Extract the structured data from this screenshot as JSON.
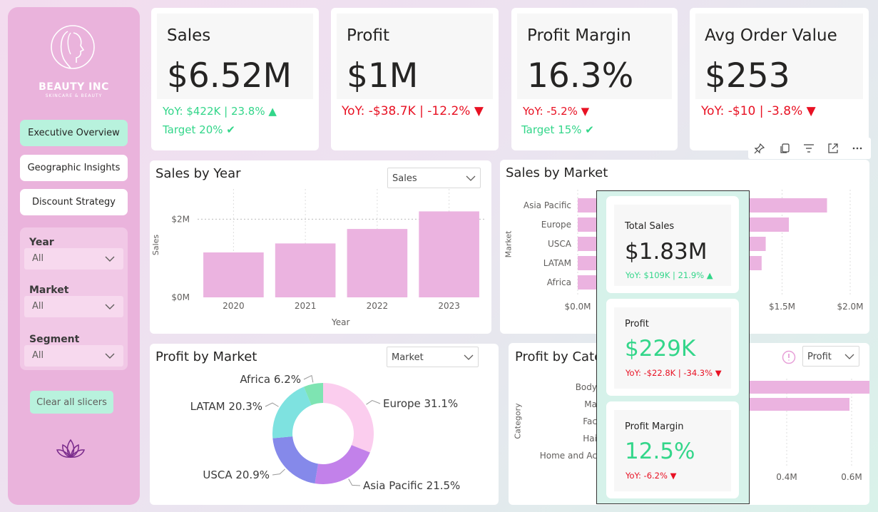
{
  "sidebar": {
    "brand": "BEAUTY INC",
    "tagline": "SKINCARE & BEAUTY",
    "nav": [
      {
        "label": "Executive Overview",
        "active": true
      },
      {
        "label": "Geographic Insights",
        "active": false
      },
      {
        "label": "Discount Strategy",
        "active": false
      }
    ],
    "slicers": [
      {
        "label": "Year",
        "value": "All"
      },
      {
        "label": "Market",
        "value": "All"
      },
      {
        "label": "Segment",
        "value": "All"
      }
    ],
    "clear_label": "Clear all slicers"
  },
  "kpis": [
    {
      "title": "Sales",
      "value": "$6.52M",
      "yoy": "YoY: $422K | 23.8% ▲",
      "yoy_color": "#33d68a",
      "target": "Target 20% ✔"
    },
    {
      "title": "Profit",
      "value": "$1M",
      "yoy": "YoY: -$38.7K | -12.2% ▼",
      "yoy_color": "#e81123",
      "target": ""
    },
    {
      "title": "Profit Margin",
      "value": "16.3%",
      "yoy": "YoY: -5.2% ▼",
      "yoy_color": "#e81123",
      "target": "Target 15% ✔"
    },
    {
      "title": "Avg Order Value",
      "value": "$253",
      "yoy": "YoY: -$10 | -3.8% ▼",
      "yoy_color": "#e81123",
      "target": ""
    }
  ],
  "sales_by_year": {
    "title": "Sales by Year",
    "dropdown": "Sales",
    "chart_data": {
      "type": "bar",
      "categories": [
        "2020",
        "2021",
        "2022",
        "2023"
      ],
      "values": [
        1.15,
        1.38,
        1.75,
        2.2
      ],
      "xlabel": "Year",
      "ylabel": "Sales",
      "yticks": [
        "$0M",
        "$2M"
      ],
      "ylim": [
        0,
        2.5
      ],
      "reference_line": 2.0
    }
  },
  "sales_by_market": {
    "title": "Sales by Market",
    "chart_data": {
      "type": "bar",
      "orientation": "horizontal",
      "categories": [
        "Asia Pacific",
        "Europe",
        "USCA",
        "LATAM",
        "Africa"
      ],
      "values": [
        1.83,
        1.55,
        1.38,
        1.35,
        0.98
      ],
      "ylabel": "Market",
      "xticks": [
        "$0.0M",
        "$1.5M",
        "$2.0M"
      ],
      "xlim": [
        0,
        2.0
      ]
    }
  },
  "profit_by_market": {
    "title": "Profit by Market",
    "dropdown": "Market",
    "chart_data": {
      "type": "pie",
      "donut": true,
      "slices": [
        {
          "label": "Europe",
          "value": 31.1,
          "display": "Europe 31.1%",
          "color": "#fbcdee"
        },
        {
          "label": "Asia Pacific",
          "value": 21.5,
          "display": "Asia Pacific 21.5%",
          "color": "#c281ea"
        },
        {
          "label": "USCA",
          "value": 20.9,
          "display": "USCA 20.9%",
          "color": "#8589ea"
        },
        {
          "label": "LATAM",
          "value": 20.3,
          "display": "LATAM 20.3%",
          "color": "#7ee2e0"
        },
        {
          "label": "Africa",
          "value": 6.2,
          "display": "Africa 6.2%",
          "color": "#7ee4b2"
        }
      ]
    }
  },
  "profit_by_category": {
    "title": "Profit by Cate",
    "dropdown": "Profit",
    "chart_data": {
      "type": "bar",
      "orientation": "horizontal",
      "categories": [
        "Body",
        "Ma",
        "Fac",
        "Hai",
        "Home and Ac"
      ],
      "values": [
        0.62,
        0.4,
        0,
        0,
        0
      ],
      "ylabel": "Category",
      "xticks": [
        "0.4M",
        "0.6M"
      ]
    }
  },
  "tooltip": {
    "cards": [
      {
        "title": "Total Sales",
        "value": "$1.83M",
        "value_color": "#252423",
        "yoy": "YoY: $109K | 21.9% ▲",
        "yoy_color": "#33d68a"
      },
      {
        "title": "Profit",
        "value": "$229K",
        "value_color": "#33d68a",
        "yoy": "YoY: -$22.8K | -34.3% ▼",
        "yoy_color": "#e81123"
      },
      {
        "title": "Profit Margin",
        "value": "12.5%",
        "value_color": "#33d68a",
        "yoy": "YoY: -6.2% ▼",
        "yoy_color": "#e81123"
      }
    ]
  },
  "visual_header_icons": [
    "pin-icon",
    "copy-icon",
    "filter-icon",
    "focus-mode-icon",
    "more-options-icon"
  ],
  "colors": {
    "bar": "#ebb3e0",
    "positive": "#33d68a",
    "negative": "#e81123",
    "active_nav": "#b8f2dd"
  }
}
